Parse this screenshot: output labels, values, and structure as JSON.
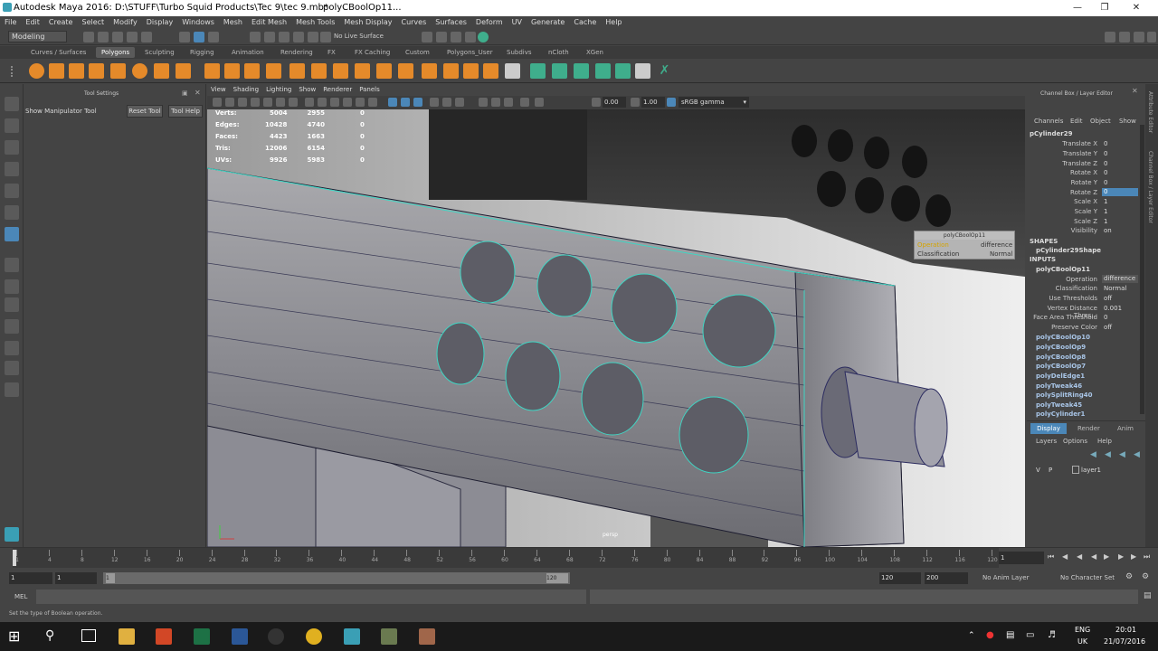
{
  "window": {
    "title": "Autodesk Maya 2016: D:\\STUFF\\Turbo Squid Products\\Tec 9\\tec 9.mb*",
    "node_title": "polyCBoolOp11..."
  },
  "menubar": [
    "File",
    "Edit",
    "Create",
    "Select",
    "Modify",
    "Display",
    "Windows",
    "Mesh",
    "Edit Mesh",
    "Mesh Tools",
    "Mesh Display",
    "Curves",
    "Surfaces",
    "Deform",
    "UV",
    "Generate",
    "Cache",
    "Help"
  ],
  "statusline": {
    "mode": "Modeling",
    "live_surface": "No Live Surface"
  },
  "shelf_tabs": [
    "Curves / Surfaces",
    "Polygons",
    "Sculpting",
    "Rigging",
    "Animation",
    "Rendering",
    "FX",
    "FX Caching",
    "Custom",
    "Polygons_User",
    "Subdivs",
    "nCloth",
    "XGen"
  ],
  "shelf_active": "Polygons",
  "tool_settings": {
    "header": "Tool Settings",
    "tool_name": "Show Manipulator Tool",
    "reset_label": "Reset Tool",
    "help_label": "Tool Help"
  },
  "viewport": {
    "menus": [
      "View",
      "Shading",
      "Lighting",
      "Show",
      "Renderer",
      "Panels"
    ],
    "exposure": "0.00",
    "gamma": "1.00",
    "color_space": "sRGB gamma",
    "camera": "persp",
    "hud": [
      {
        "label": "Verts:",
        "a": "5004",
        "b": "2955",
        "c": "0"
      },
      {
        "label": "Edges:",
        "a": "10428",
        "b": "4740",
        "c": "0"
      },
      {
        "label": "Faces:",
        "a": "4423",
        "b": "1663",
        "c": "0"
      },
      {
        "label": "Tris:",
        "a": "12006",
        "b": "6154",
        "c": "0"
      },
      {
        "label": "UVs:",
        "a": "9926",
        "b": "5983",
        "c": "0"
      }
    ],
    "popup": {
      "title": "polyCBoolOp11",
      "rows": [
        {
          "label": "Operation",
          "value": "difference"
        },
        {
          "label": "Classification",
          "value": "Normal"
        }
      ]
    }
  },
  "channel_box": {
    "header": "Channel Box / Layer Editor",
    "menus": [
      "Channels",
      "Edit",
      "Object",
      "Show"
    ],
    "object": "pCylinder29",
    "attributes": [
      {
        "label": "Translate X",
        "value": "0"
      },
      {
        "label": "Translate Y",
        "value": "0"
      },
      {
        "label": "Translate Z",
        "value": "0"
      },
      {
        "label": "Rotate X",
        "value": "0"
      },
      {
        "label": "Rotate Y",
        "value": "0"
      },
      {
        "label": "Rotate Z",
        "value": "0"
      },
      {
        "label": "Scale X",
        "value": "1"
      },
      {
        "label": "Scale Y",
        "value": "1"
      },
      {
        "label": "Scale Z",
        "value": "1"
      },
      {
        "label": "Visibility",
        "value": "on"
      }
    ],
    "shapes_label": "SHAPES",
    "shape": "pCylinder29Shape",
    "inputs_label": "INPUTS",
    "input_node": "polyCBoolOp11",
    "input_attrs": [
      {
        "label": "Operation",
        "value": "difference"
      },
      {
        "label": "Classification",
        "value": "Normal"
      },
      {
        "label": "Use Thresholds",
        "value": "off"
      },
      {
        "label": "Vertex Distance Thres...",
        "value": "0.001"
      },
      {
        "label": "Face Area Threshold",
        "value": "0"
      },
      {
        "label": "Preserve Color",
        "value": "off"
      }
    ],
    "history": [
      "polyCBoolOp10",
      "polyCBoolOp9",
      "polyCBoolOp8",
      "polyCBoolOp7",
      "polyDelEdge1",
      "polyTweak46",
      "polySplitRing40",
      "polyTweak45",
      "polyCylinder1"
    ]
  },
  "layer_editor": {
    "tabs": [
      "Display",
      "Render",
      "Anim"
    ],
    "menus": [
      "Layers",
      "Options",
      "Help"
    ],
    "layer": {
      "v": "V",
      "p": "P",
      "name": "layer1"
    }
  },
  "right_strip": [
    "Attribute Editor",
    "Channel Box / Layer Editor"
  ],
  "timeline": {
    "ticks": [
      "1",
      "4",
      "8",
      "12",
      "16",
      "20",
      "24",
      "28",
      "32",
      "36",
      "40",
      "44",
      "48",
      "52",
      "56",
      "60",
      "64",
      "68",
      "72",
      "76",
      "80",
      "84",
      "88",
      "92",
      "96",
      "100",
      "104",
      "108",
      "112",
      "116",
      "120"
    ],
    "current": "1"
  },
  "range": {
    "start": "1",
    "playback_start": "1",
    "slider_start": "1",
    "slider_end": "120",
    "playback_end": "120",
    "end": "200",
    "anim_layer": "No Anim Layer",
    "char_set": "No Character Set"
  },
  "cmdline": {
    "label": "MEL"
  },
  "helpline": "Set the type of Boolean operation.",
  "taskbar": {
    "lang1": "ENG",
    "lang2": "UK",
    "time": "20:01",
    "date": "21/07/2016"
  }
}
